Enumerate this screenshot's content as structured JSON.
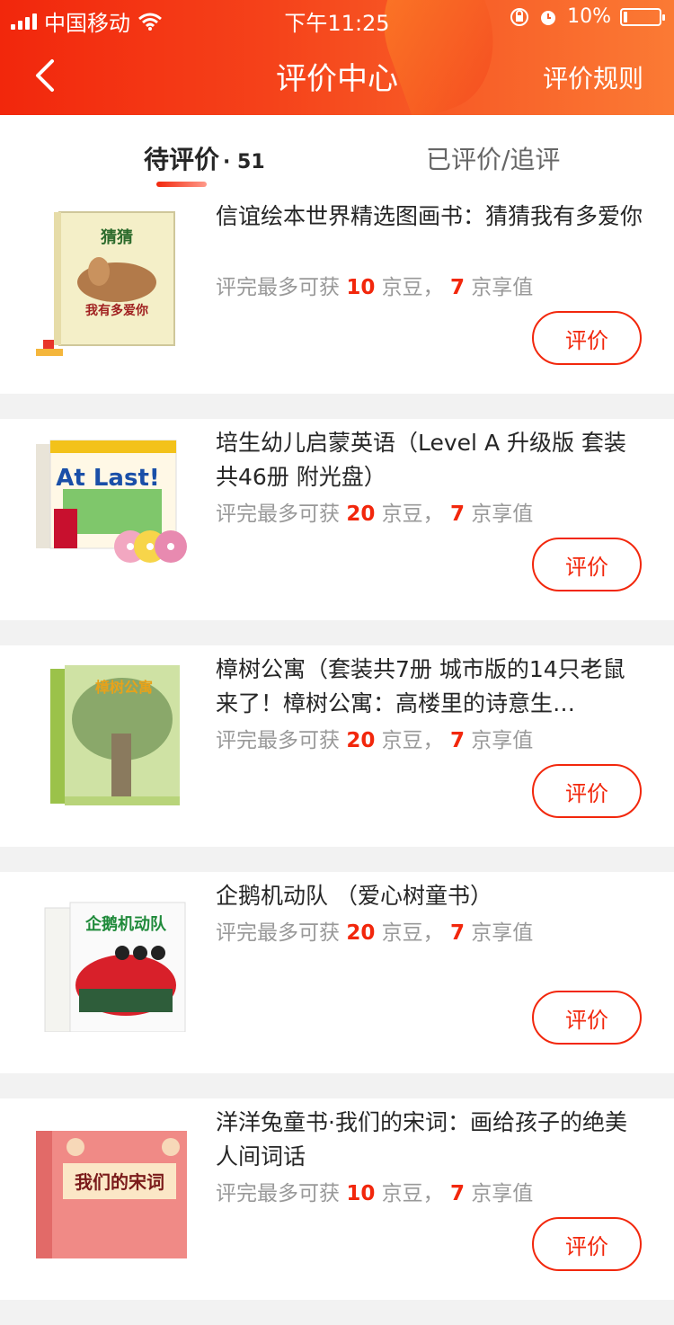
{
  "status_bar": {
    "carrier": "中国移动",
    "time": "下午11:25",
    "battery": "10%",
    "battery_level": 0.1
  },
  "nav": {
    "title": "评价中心",
    "rules": "评价规则"
  },
  "tabs": {
    "pending_label": "待评价",
    "pending_count": "· 51",
    "done_label": "已评价/追评"
  },
  "reward_template": {
    "prefix": "评完最多可获",
    "bean_unit": "京豆，",
    "value_unit": "京享值"
  },
  "items": [
    {
      "name": "信谊绘本世界精选图画书：猜猜我有多爱你",
      "beans": "10",
      "value": "7",
      "button": "评价",
      "cover_text": "猜猜我有多爱你"
    },
    {
      "name": "培生幼儿启蒙英语（Level A 升级版 套装共46册 附光盘）",
      "beans": "20",
      "value": "7",
      "button": "评价",
      "cover_text": "At Last!"
    },
    {
      "name": "樟树公寓（套装共7册 城市版的14只老鼠来了！樟树公寓：高楼里的诗意生…",
      "beans": "20",
      "value": "7",
      "button": "评价",
      "cover_text": "樟树公寓"
    },
    {
      "name": "企鹅机动队 （爱心树童书）",
      "beans": "20",
      "value": "7",
      "button": "评价",
      "cover_text": "企鹅机动队"
    },
    {
      "name": "洋洋兔童书·我们的宋词：画给孩子的绝美人间词话",
      "beans": "10",
      "value": "7",
      "button": "评价",
      "cover_text": "我们的宋词"
    }
  ]
}
